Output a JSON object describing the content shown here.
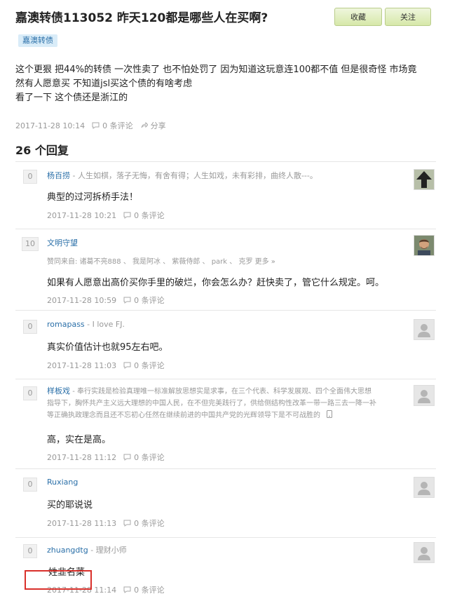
{
  "question": {
    "title": "嘉澳转债113052 昨天120都是哪些人在买啊?",
    "tag": "嘉澳转债",
    "body_lines": [
      "这个更狠 把44%的转债 一次性卖了 也不怕处罚了 因为知道这玩意连100都不值 但是很奇怪 市场竟",
      "然有人愿意买 不知道jsl买这个债的有啥考虑",
      "看了一下 这个债还是浙江的"
    ],
    "date": "2017-11-28 10:14",
    "comments": "0 条评论",
    "share": "分享"
  },
  "buttons": {
    "favorite": "收藏",
    "follow": "关注"
  },
  "replies_heading": "26 个回复",
  "replies": [
    {
      "votes": "0",
      "author": "杨百捞",
      "signature": "- 人生如棋，落子无悔，有舍有得；人生如戏，未有彩排，曲终人散---。",
      "text": "典型的过河拆桥手法！",
      "date": "2017-11-28 10:21",
      "comments": "0 条评论",
      "avatar": "arrow-avatar"
    },
    {
      "votes": "10",
      "author": "文明守望",
      "likers": "赞同来自: 诸葛不亮888 、 我是阿冰 、 紫薇侍郎 、 park 、 克罗  更多 »",
      "text": "如果有人愿意出高价买你手里的破烂，你会怎么办？赶快卖了，管它什么规定。呵。",
      "date": "2017-11-28 10:59",
      "comments": "0 条评论",
      "avatar": "photo-avatar"
    },
    {
      "votes": "0",
      "author": "romapass",
      "signature": "- I love FJ.",
      "text": "真实价值估计也就95左右吧。",
      "date": "2017-11-28 11:03",
      "comments": "0 条评论",
      "avatar": "default-avatar"
    },
    {
      "votes": "0",
      "author": "样板戏",
      "signature_lines": [
        "- 奉行实践是检验真理唯一标准解放思想实是求事，在三个代表、科学发展观、四个全面伟大思想",
        "指导下，胸怀共产主义远大理想的中国人民，在不但完美践行了，供给侧结构性改革一带一路三去一降一补",
        "等正确执政理念而且还不忘初心任然在继续前进的中国共产党的光辉领导下是不可战胜的"
      ],
      "text": "高，实在是高。",
      "date": "2017-11-28 11:12",
      "comments": "0 条评论",
      "avatar": "default-avatar"
    },
    {
      "votes": "0",
      "author": "Ruxiang",
      "text": "买的耶说说",
      "date": "2017-11-28 11:13",
      "comments": "0 条评论",
      "avatar": "default-avatar"
    },
    {
      "votes": "0",
      "author": "zhuangdtg",
      "signature": "- 理财小师",
      "text": "姓韭名菜",
      "date": "2017-11-28 11:14",
      "comments": "0 条评论",
      "avatar": "default-avatar"
    }
  ],
  "colors": {
    "link": "#2a6fa8",
    "highlight": "#d9302b",
    "button": "#d7e8a9"
  }
}
